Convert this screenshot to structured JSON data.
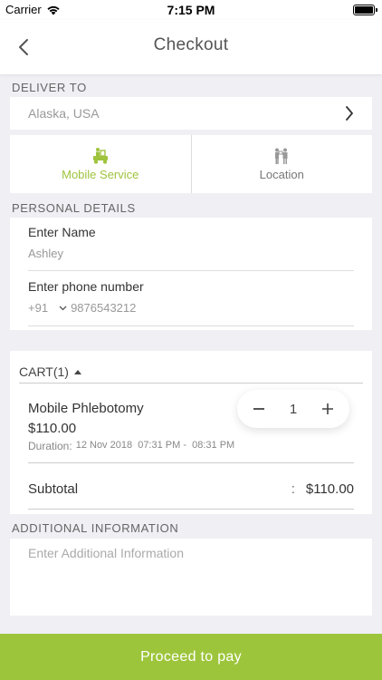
{
  "status_bar": {
    "carrier": "Carrier",
    "time": "7:15 PM"
  },
  "nav": {
    "title": "Checkout"
  },
  "deliver": {
    "label": "DELIVER TO",
    "value": "Alaska, USA"
  },
  "service_tabs": [
    {
      "label": "Mobile Service",
      "active": true,
      "icon": "mobile-service-icon"
    },
    {
      "label": "Location",
      "active": false,
      "icon": "location-icon"
    }
  ],
  "personal": {
    "label": "PERSONAL DETAILS",
    "name_label": "Enter Name",
    "name_value": "Ashley",
    "phone_label": "Enter phone number",
    "country_code": "+91",
    "phone_value": "9876543212"
  },
  "cart": {
    "header": "CART(1)",
    "item_name": "Mobile Phlebotomy",
    "item_price": "$110.00",
    "duration_label": "Duration:",
    "duration_value": "12 Nov 2018  07:31 PM -  08:31 PM",
    "quantity": "1",
    "subtotal_label": "Subtotal",
    "subtotal_colon": ":",
    "subtotal_value": "$110.00"
  },
  "additional": {
    "label": "ADDITIONAL INFORMATION",
    "placeholder": "Enter Additional Information"
  },
  "proceed": {
    "label": "Proceed to pay"
  },
  "colors": {
    "accent": "#9dc53c",
    "background": "#efeff4"
  }
}
